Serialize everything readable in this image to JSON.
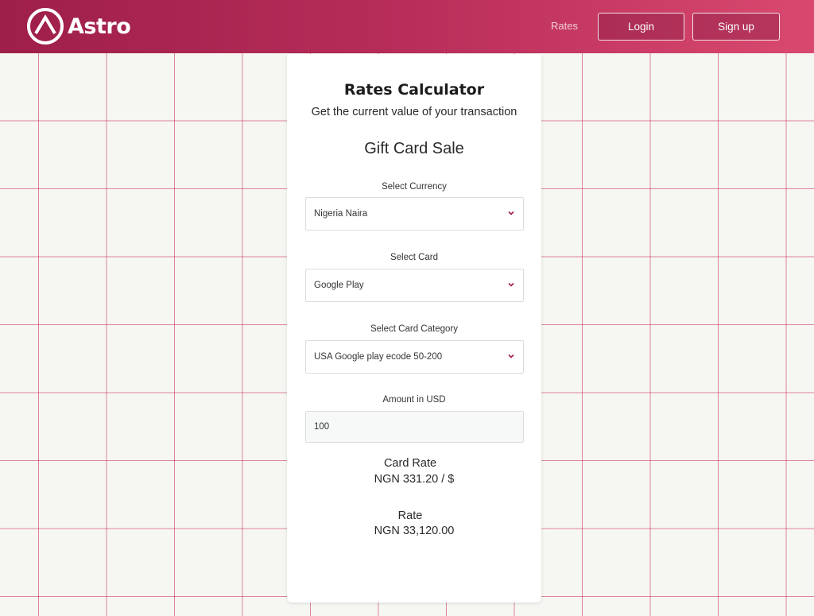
{
  "header": {
    "brand": "Astro",
    "nav_rates": "Rates",
    "login_label": "Login",
    "signup_label": "Sign up"
  },
  "calculator": {
    "title": "Rates Calculator",
    "subtitle": "Get the current value of your transaction",
    "section": "Gift Card Sale",
    "currency": {
      "label": "Select Currency",
      "value": "Nigeria Naira"
    },
    "card": {
      "label": "Select Card",
      "value": "Google Play"
    },
    "category": {
      "label": "Select Card Category",
      "value": "USA Google play ecode 50-200"
    },
    "amount": {
      "label": "Amount in USD",
      "value": "100"
    },
    "card_rate": {
      "label": "Card Rate",
      "value": "NGN 331.20 / $"
    },
    "rate": {
      "label": "Rate",
      "value": "NGN 33,120.00"
    }
  },
  "colors": {
    "header_start": "#9e1f4a",
    "header_end": "#d9496f",
    "grid_line": "#c82850",
    "chevron": "#a01c44"
  },
  "icons": {
    "logo": "astro-logo-icon",
    "dropdown": "chevron-down-icon"
  }
}
